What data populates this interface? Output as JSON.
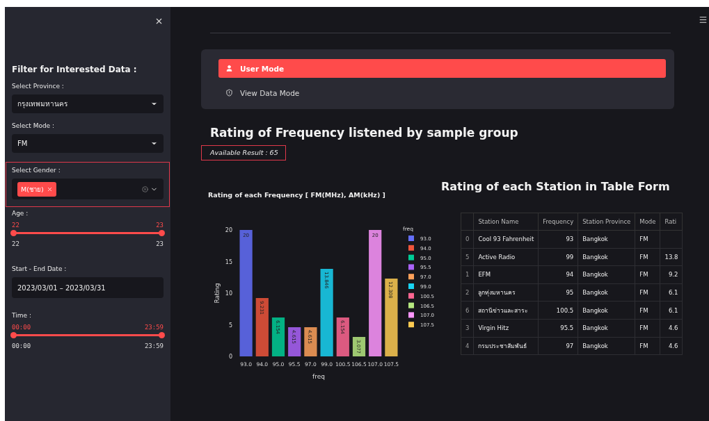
{
  "sidebar": {
    "title": "Filter for Interested Data :",
    "filters": [
      {
        "kind": "select",
        "label": "Select Province :",
        "value": "กรุงเทพมหานคร"
      },
      {
        "kind": "select",
        "label": "Select Mode :",
        "value": "FM"
      },
      {
        "kind": "multiselect",
        "label": "Select Gender :",
        "highlighted": true,
        "chips": [
          "M(ชาย)"
        ]
      },
      {
        "kind": "range",
        "label": "Age :",
        "low": "22",
        "high": "23",
        "min": "22",
        "max": "23",
        "level": 1
      },
      {
        "kind": "date",
        "label": "Start - End Date :",
        "value": "2023/03/01 – 2023/03/31"
      },
      {
        "kind": "range",
        "label": "Time :",
        "low": "00:00",
        "high": "23:59",
        "min": "00:00",
        "max": "23:59",
        "level": 1
      }
    ]
  },
  "nav": [
    {
      "label": "User Mode",
      "selected": true
    },
    {
      "label": "View Data Mode",
      "selected": false
    }
  ],
  "heading": "Rating of Frequency listened by sample group",
  "available_result": {
    "text": "Available Result : 65",
    "highlighted": true
  },
  "chart": {
    "title": "Rating of each Frequency [ FM(MHz), AM(kHz) ]",
    "chart_data": {
      "type": "bar",
      "xlabel": "freq",
      "ylabel": "Rating",
      "legend_title": "freq",
      "categories": [
        "93.0",
        "94.0",
        "95.0",
        "95.5",
        "97.0",
        "99.0",
        "100.5",
        "106.5",
        "107.0",
        "107.5"
      ],
      "values": [
        20,
        9.231,
        6.154,
        4.615,
        4.615,
        13.846,
        6.154,
        3.077,
        20,
        12.308
      ],
      "value_labels": [
        "20",
        "9.231",
        "6.154",
        "4.615",
        "4.615",
        "13.846",
        "6.154",
        "3.077",
        "20",
        "12.308"
      ],
      "colors": [
        "#636efa",
        "#ef553b",
        "#00cc96",
        "#ab63fa",
        "#ffa15a",
        "#19d3f3",
        "#ff6692",
        "#b6e880",
        "#ff97ff",
        "#fecb52"
      ],
      "ylim": [
        0,
        20
      ],
      "yticks": [
        0,
        5,
        10,
        15,
        20
      ]
    }
  },
  "table": {
    "title": "Rating of each Station in Table Form",
    "columns": [
      "Station Name",
      "Frequency",
      "Station Province",
      "Mode",
      "Rati"
    ],
    "rows": [
      {
        "index": "0",
        "cells": [
          "Cool 93 Fahrenheit",
          "93",
          "Bangkok",
          "FM"
        ]
      },
      {
        "index": "5",
        "cells": [
          "Active Radio",
          "99",
          "Bangkok",
          "FM",
          "13.8"
        ]
      },
      {
        "index": "1",
        "cells": [
          "EFM",
          "94",
          "Bangkok",
          "FM",
          "9.2"
        ]
      },
      {
        "index": "2",
        "cells": [
          "ลูกทุ่งมหานคร",
          "95",
          "Bangkok",
          "FM",
          "6.1"
        ]
      },
      {
        "index": "6",
        "cells": [
          "สถานีข่าวและสาระ",
          "100.5",
          "Bangkok",
          "FM",
          "6.1"
        ]
      },
      {
        "index": "3",
        "cells": [
          "Virgin Hitz",
          "95.5",
          "Bangkok",
          "FM",
          "4.6"
        ]
      },
      {
        "index": "4",
        "cells": [
          "กรมประชาสัมพันธ์",
          "97",
          "Bangkok",
          "FM",
          "4.6"
        ]
      }
    ]
  }
}
